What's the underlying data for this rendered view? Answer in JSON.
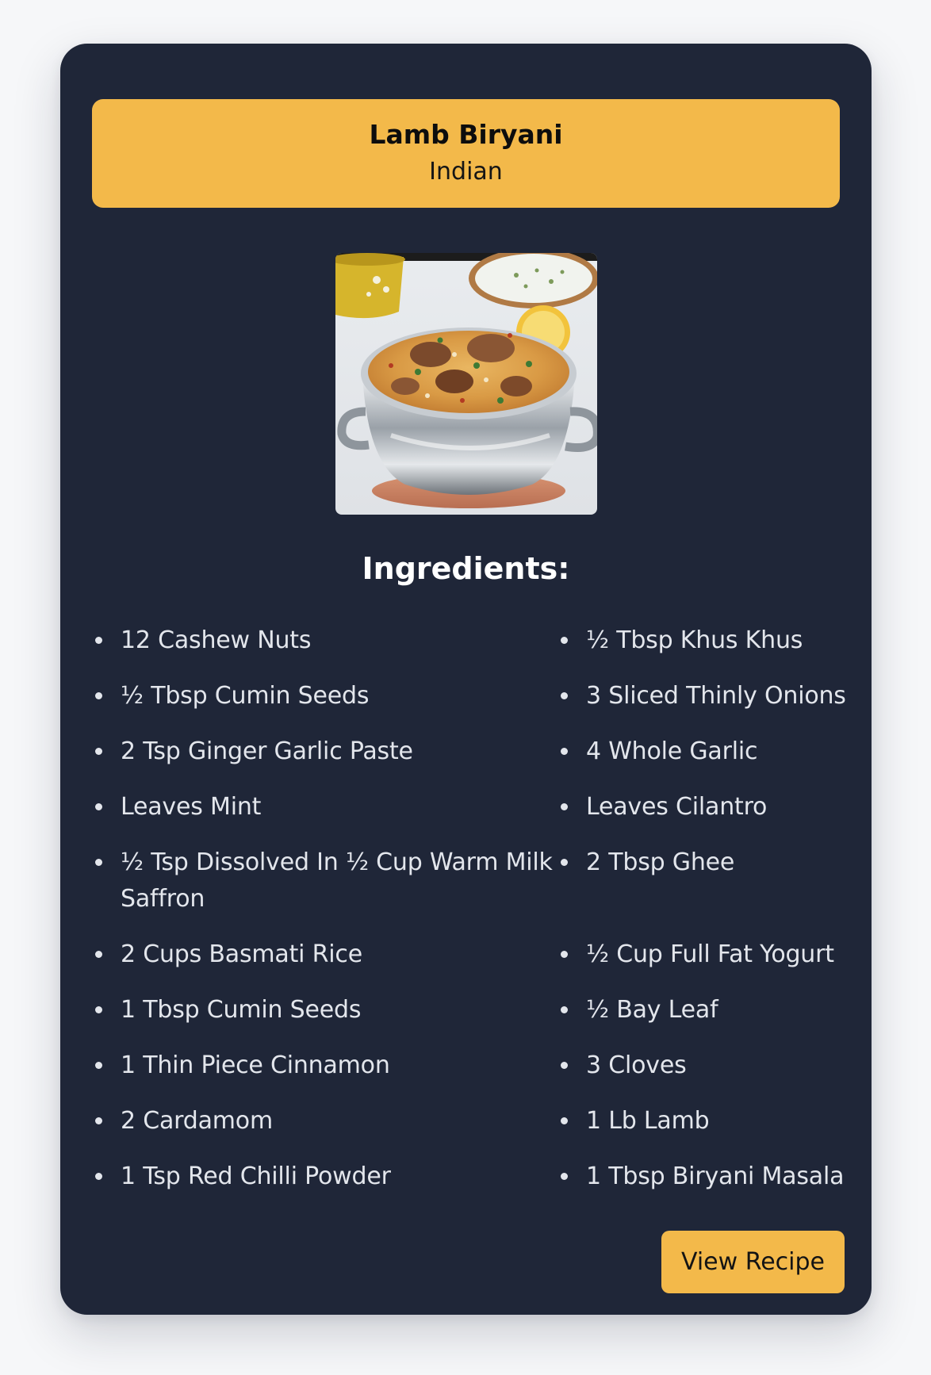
{
  "recipe": {
    "title": "Lamb Biryani",
    "cuisine": "Indian",
    "image_alt": "Lamb biryani in a steel pot"
  },
  "ingredients": {
    "heading": "Ingredients:",
    "left": [
      "12 Cashew Nuts",
      "½ Tbsp Cumin Seeds",
      "2 Tsp Ginger Garlic Paste",
      "Leaves Mint",
      "½ Tsp Dissolved In ½ Cup Warm Milk Saffron",
      "2 Cups Basmati Rice",
      "1 Tbsp Cumin Seeds",
      "1 Thin Piece Cinnamon",
      "2 Cardamom",
      "1 Tsp Red Chilli Powder"
    ],
    "right": [
      "½ Tbsp Khus Khus",
      "3 Sliced Thinly Onions",
      "4 Whole Garlic",
      "Leaves Cilantro",
      "2 Tbsp Ghee",
      "½ Cup Full Fat Yogurt",
      "½ Bay Leaf",
      "3 Cloves",
      "1 Lb Lamb",
      "1 Tbsp Biryani Masala"
    ]
  },
  "actions": {
    "view_recipe_label": "View Recipe"
  },
  "colors": {
    "card_bg": "#1f2638",
    "accent": "#f3b94a",
    "text_light": "#e3e6ec",
    "page_bg": "#f6f7f9"
  }
}
